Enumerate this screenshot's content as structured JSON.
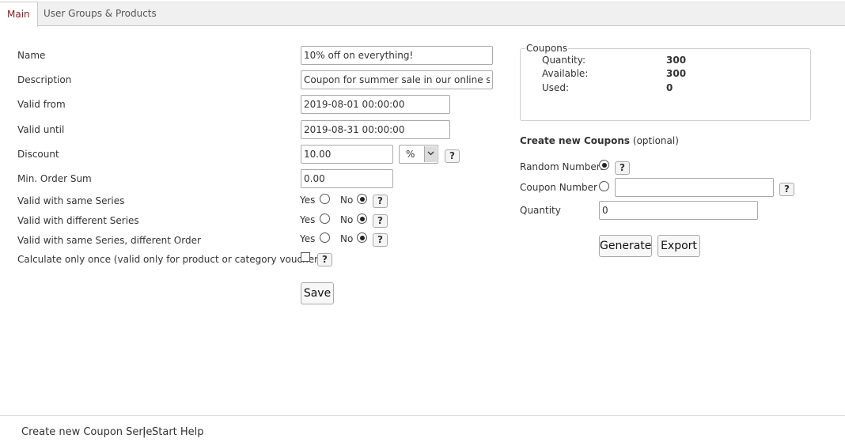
{
  "tabs": {
    "main": "Main",
    "groups": "User Groups & Products"
  },
  "form": {
    "name_label": "Name",
    "name_value": "10% off on everything!",
    "description_label": "Description",
    "description_value": "Coupon for summer sale in our online shop.",
    "valid_from_label": "Valid from",
    "valid_from_value": "2019-08-01 00:00:00",
    "valid_until_label": "Valid until",
    "valid_until_value": "2019-08-31 00:00:00",
    "discount_label": "Discount",
    "discount_value": "10.00",
    "discount_unit": "%",
    "min_order_label": "Min. Order Sum",
    "min_order_value": "0.00",
    "same_series_label": "Valid with same Series",
    "diff_series_label": "Valid with different Series",
    "same_series_diff_order_label": "Valid with same Series, different Order",
    "calc_once_label": "Calculate only once (valid only for product or category vouchers)",
    "yes": "Yes",
    "no": "No",
    "help": "?",
    "save": "Save"
  },
  "coupons": {
    "legend": "Coupons",
    "quantity_label": "Quantity:",
    "quantity_value": "300",
    "available_label": "Available:",
    "available_value": "300",
    "used_label": "Used:",
    "used_value": "0"
  },
  "create": {
    "title": "Create new Coupons",
    "optional": "(optional)",
    "random_label": "Random Numbers",
    "coupon_number_label": "Coupon Number",
    "coupon_number_value": "",
    "quantity_label": "Quantity",
    "quantity_value": "0",
    "generate": "Generate",
    "export": "Export"
  },
  "footer": {
    "create_serie": "Create new Coupon Serie",
    "separator": "|",
    "start_help": "Start Help"
  },
  "colors": {
    "active_tab": "#8b1a1a",
    "tabbar_bg": "#f0f0f0"
  }
}
